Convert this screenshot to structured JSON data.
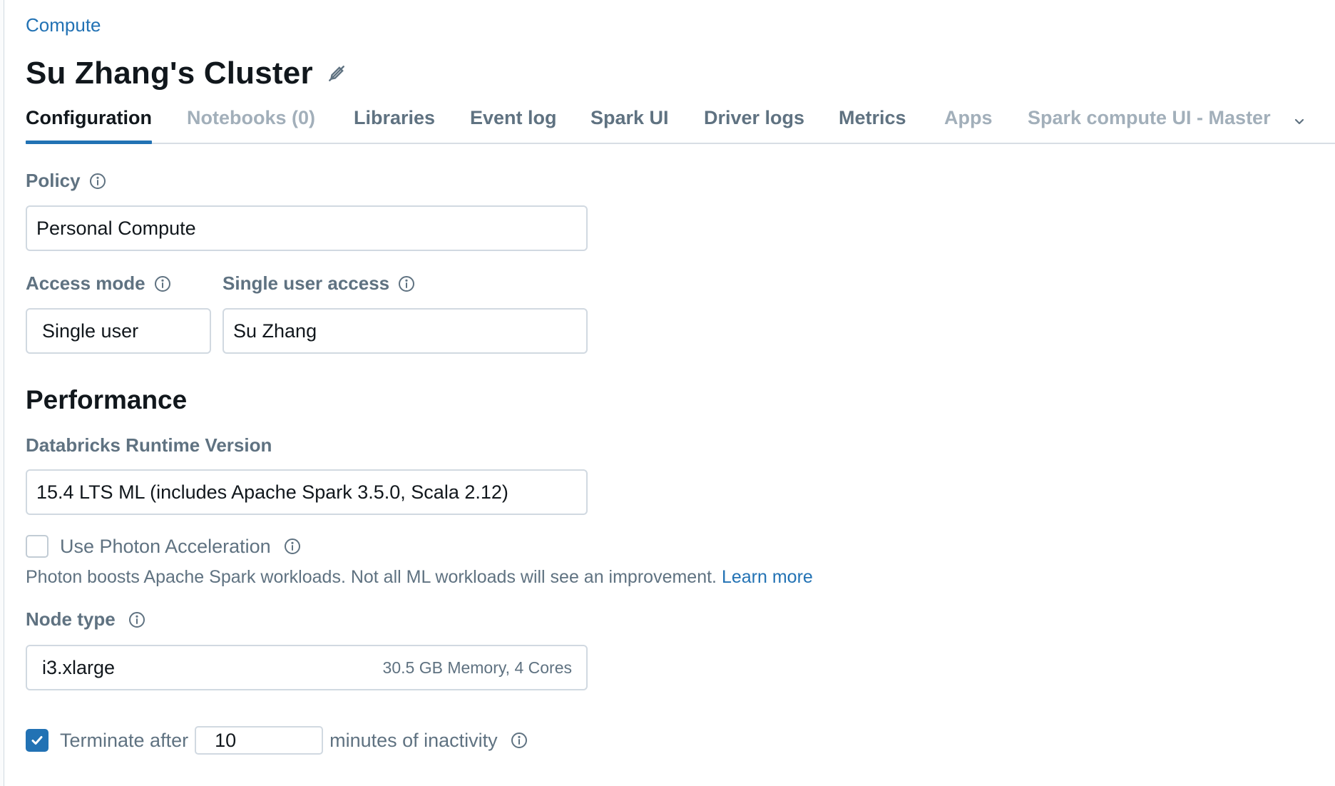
{
  "breadcrumb": {
    "label": "Compute"
  },
  "page": {
    "title": "Su Zhang's Cluster"
  },
  "tabs": [
    {
      "label": "Configuration",
      "state": "active"
    },
    {
      "label": "Notebooks (0)",
      "state": "disabled"
    },
    {
      "label": "Libraries",
      "state": "normal"
    },
    {
      "label": "Event log",
      "state": "normal"
    },
    {
      "label": "Spark UI",
      "state": "normal"
    },
    {
      "label": "Driver logs",
      "state": "normal"
    },
    {
      "label": "Metrics",
      "state": "normal"
    },
    {
      "label": "Apps",
      "state": "disabled"
    }
  ],
  "tab_dropdown": {
    "label": "Spark compute UI - Master"
  },
  "policy": {
    "label": "Policy",
    "value": "Personal Compute"
  },
  "access_mode": {
    "label": "Access mode",
    "value": "Single user"
  },
  "single_user_access": {
    "label": "Single user access",
    "value": "Su Zhang"
  },
  "performance": {
    "title": "Performance",
    "runtime_label": "Databricks Runtime Version",
    "runtime_value": "15.4 LTS ML (includes Apache Spark 3.5.0, Scala 2.12)"
  },
  "photon": {
    "label": "Use Photon Acceleration",
    "checked": false,
    "help_text": "Photon boosts Apache Spark workloads. Not all ML workloads will see an improvement.",
    "learn_more": "Learn more"
  },
  "node_type": {
    "label": "Node type",
    "value": "i3.xlarge",
    "detail": "30.5 GB Memory, 4 Cores"
  },
  "terminate": {
    "checked": true,
    "label_before": "Terminate after",
    "minutes": "10",
    "label_after": "minutes of inactivity"
  },
  "colors": {
    "accent": "#2272b4",
    "label": "#5f7281",
    "disabled": "#a2afba",
    "border": "#d1d9e1"
  }
}
